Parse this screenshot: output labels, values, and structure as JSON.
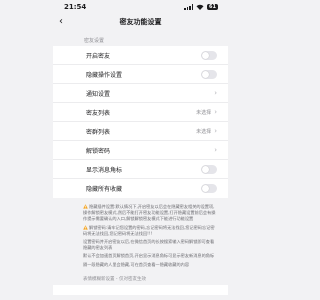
{
  "status_bar": {
    "time": "21:54",
    "battery": "61"
  },
  "nav": {
    "title": "密友功能设置"
  },
  "section_title": "密友设置",
  "rows": [
    {
      "label": "开启密友",
      "type": "toggle"
    },
    {
      "label": "隐藏操作设置",
      "type": "toggle"
    },
    {
      "label": "通知设置",
      "type": "chevron"
    },
    {
      "label": "密友列表",
      "type": "value",
      "value": "未选择"
    },
    {
      "label": "密群列表",
      "type": "value",
      "value": "未选择"
    },
    {
      "label": "解锁密码",
      "type": "chevron"
    },
    {
      "label": "显示消息角标",
      "type": "toggle"
    },
    {
      "label": "隐藏所有收藏",
      "type": "toggle"
    }
  ],
  "notes": [
    "隐藏插件设置:默认情况下,开启密友以后会在隐藏密友相关的设置项,操作解锁密友模式,然后不能打开密友功能设置,打开隐藏设置前后会有操作提示需要确认的入口,解锁解锁密友模式下能进行功能设置",
    "解锁密码:请牢记您设置的密码,忘记密码将无法找回,您记密码忘记密码将无法找回,您记密码将无法找回!!!",
    "设置密码并开启密友以后,在微信首页的长按搜索输入密码解锁即可查看隐藏的密友列表",
    "默认不会加速首页解锁首页,开启显示消息角标可显示密友新消息的角标",
    "隔一段隐藏的人里会隐藏,可在首页查看一隐藏收藏的内容"
  ],
  "footer_label": "表情模糊新设置 - 仅对密友生效",
  "icons": {
    "back": "chevron-left-icon",
    "chevron": "chevron-right-icon",
    "warning": "warning-icon"
  },
  "colors": {
    "background": "#f2f2f4",
    "toggle_off": "#e5e5ea",
    "warning": "#f5a623"
  }
}
